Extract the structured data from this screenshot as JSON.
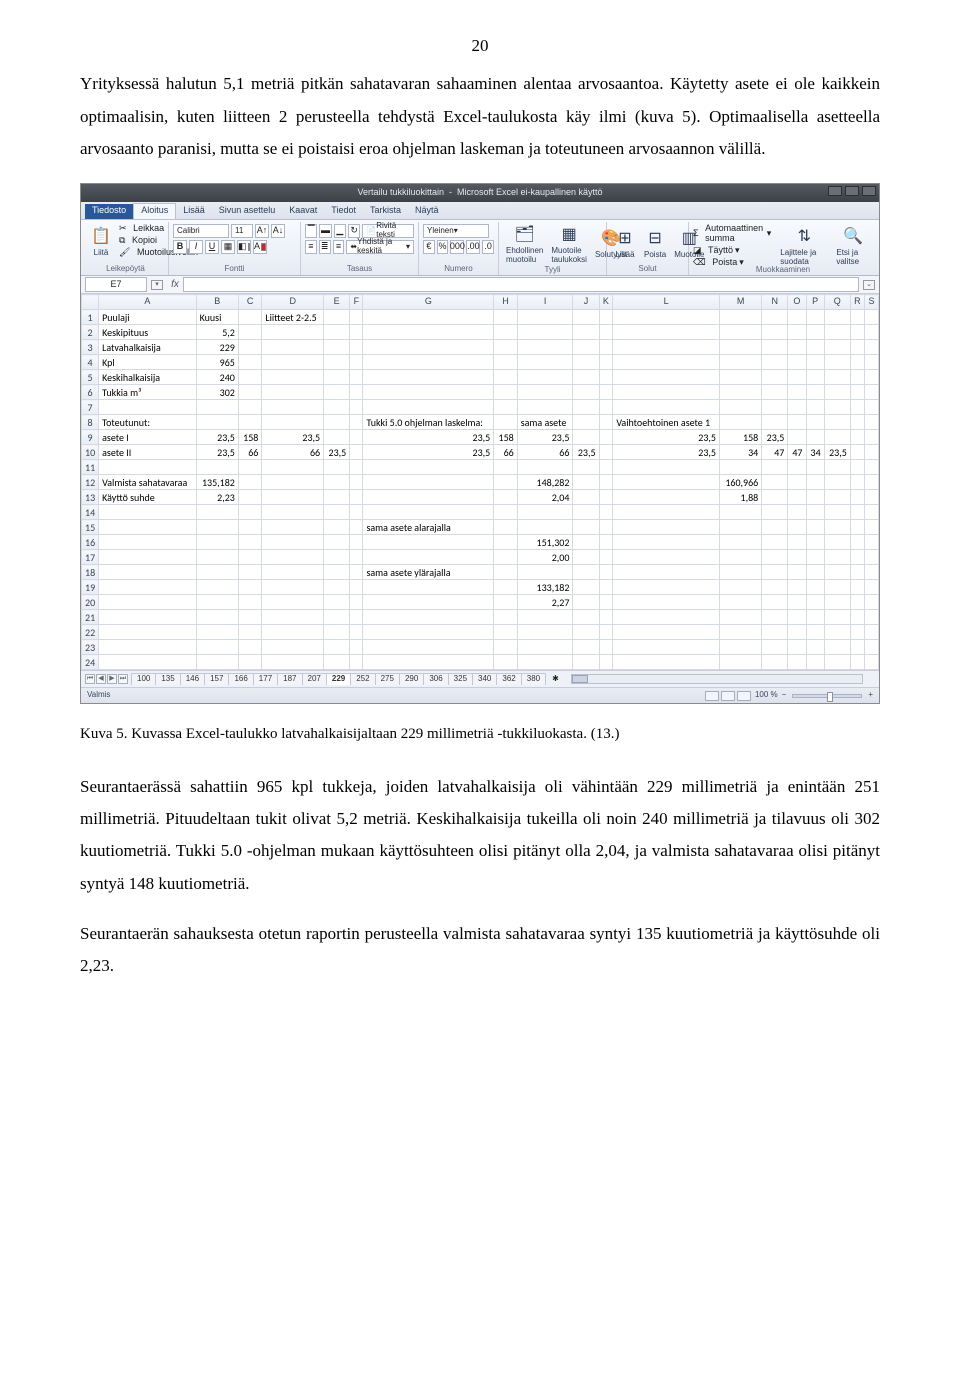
{
  "page_number": "20",
  "para1": "Yrityksessä halutun 5,1 metriä pitkän sahatavaran sahaaminen alentaa arvosaantoa. Käytetty asete ei ole kaikkein optimaalisin, kuten liitteen 2 perusteella tehdystä Excel-taulukosta käy ilmi (kuva 5). Optimaalisella asetteella arvosaanto paranisi, mutta se ei poistaisi eroa ohjelman laskeman ja toteutuneen arvosaannon välillä.",
  "caption": "Kuva 5. Kuvassa Excel-taulukko latvahalkaisijaltaan 229 millimetriä -tukkiluokasta. (13.)",
  "para2": "Seurantaerässä sahattiin 965 kpl tukkeja, joiden latvahalkaisija oli vähintään 229 millimetriä ja enintään 251 millimetriä. Pituudeltaan tukit olivat 5,2 metriä. Keskihalkaisija tukeilla oli noin 240 millimetriä ja tilavuus oli 302 kuutiometriä. Tukki 5.0 -ohjelman mukaan käyttösuhteen olisi pitänyt olla 2,04, ja valmista sahatavaraa olisi pitänyt syntyä 148 kuutiometriä.",
  "para3": "Seurantaerän sahauksesta otetun raportin perusteella valmista sahatavaraa syntyi 135 kuutiometriä ja käyttösuhde oli 2,23.",
  "excel": {
    "title_doc": "Vertailu tukkiluokittain",
    "title_app": "Microsoft Excel ei-kaupallinen käyttö",
    "tabs": [
      "Tiedosto",
      "Aloitus",
      "Lisää",
      "Sivun asettelu",
      "Kaavat",
      "Tiedot",
      "Tarkista",
      "Näytä"
    ],
    "clipboard_items": [
      "Leikkaa",
      "Kopioi",
      "Muotoilusivellin"
    ],
    "group_clipboard": "Leikepöytä",
    "paste": "Liitä",
    "font_name": "Calibri",
    "font_size": "11",
    "group_font": "Fontti",
    "group_align": "Tasaus",
    "wrap": "Rivitä teksti",
    "merge": "Yhdistä ja keskitä",
    "numfmt": "Yleinen",
    "group_number": "Numero",
    "cond": "Ehdollinen muotoilu",
    "tblfmt": "Muotoile taulukoksi",
    "styles": "Solutyylit",
    "group_styles": "Tyyli",
    "insert": "Lisää",
    "delete": "Poista",
    "format": "Muotoile",
    "group_cells": "Solut",
    "autosum": "Automaattinen summa",
    "fill": "Täyttö",
    "clear": "Poista",
    "sort": "Lajittele ja suodata",
    "find": "Etsi ja valitse",
    "group_edit": "Muokkaaminen",
    "namebox": "E7",
    "status": "Valmis",
    "zoom": "100 %",
    "cols": [
      "",
      "A",
      "B",
      "C",
      "D",
      "E",
      "F",
      "G",
      "H",
      "I",
      "J",
      "K",
      "L",
      "M",
      "N",
      "O",
      "P",
      "Q",
      "R",
      "S"
    ],
    "rows": [
      {
        "n": "1",
        "cells": [
          "Puulaji",
          "Kuusi",
          "",
          "Liitteet 2-2.5"
        ]
      },
      {
        "n": "2",
        "cells": [
          "Keskipituus",
          "5,2"
        ]
      },
      {
        "n": "3",
        "cells": [
          "Latvahalkaisija",
          "229"
        ]
      },
      {
        "n": "4",
        "cells": [
          "Kpl",
          "965"
        ]
      },
      {
        "n": "5",
        "cells": [
          "Keskihalkaisija",
          "240"
        ]
      },
      {
        "n": "6",
        "cells": [
          "Tukkia m³",
          "302"
        ]
      },
      {
        "n": "7",
        "cells": []
      },
      {
        "n": "8",
        "cells": [
          "Toteutunut:",
          "",
          "",
          "",
          "",
          "",
          "Tukki 5.0 ohjelman laskelma:",
          "",
          "sama asete",
          "",
          "",
          "Vaihtoehtoinen asete 1"
        ]
      },
      {
        "n": "9",
        "cells": [
          "asete I",
          "23,5",
          "158",
          "23,5",
          "",
          "",
          "23,5",
          "158",
          "23,5",
          "",
          "",
          "23,5",
          "158",
          "23,5"
        ]
      },
      {
        "n": "10",
        "cells": [
          "asete II",
          "23,5",
          "66",
          "66",
          "23,5",
          "",
          "23,5",
          "66",
          "66",
          "23,5",
          "",
          "23,5",
          "34",
          "47",
          "47",
          "34",
          "23,5"
        ]
      },
      {
        "n": "11",
        "cells": []
      },
      {
        "n": "12",
        "cells": [
          "Valmista sahatavaraa",
          "135,182",
          "",
          "",
          "",
          "",
          "",
          "",
          "148,282",
          "",
          "",
          "",
          "160,966"
        ]
      },
      {
        "n": "13",
        "cells": [
          "Käyttö suhde",
          "2,23",
          "",
          "",
          "",
          "",
          "",
          "",
          "2,04",
          "",
          "",
          "",
          "1,88"
        ]
      },
      {
        "n": "14",
        "cells": []
      },
      {
        "n": "15",
        "cells": [
          "",
          "",
          "",
          "",
          "",
          "",
          "sama asete alarajalla"
        ]
      },
      {
        "n": "16",
        "cells": [
          "",
          "",
          "",
          "",
          "",
          "",
          "",
          "",
          "151,302"
        ]
      },
      {
        "n": "17",
        "cells": [
          "",
          "",
          "",
          "",
          "",
          "",
          "",
          "",
          "2,00"
        ]
      },
      {
        "n": "18",
        "cells": [
          "",
          "",
          "",
          "",
          "",
          "",
          "sama asete ylärajalla"
        ]
      },
      {
        "n": "19",
        "cells": [
          "",
          "",
          "",
          "",
          "",
          "",
          "",
          "",
          "133,182"
        ]
      },
      {
        "n": "20",
        "cells": [
          "",
          "",
          "",
          "",
          "",
          "",
          "",
          "",
          "2,27"
        ]
      },
      {
        "n": "21",
        "cells": []
      },
      {
        "n": "22",
        "cells": []
      },
      {
        "n": "23",
        "cells": []
      },
      {
        "n": "24",
        "cells": []
      }
    ],
    "sheets": [
      "100",
      "135",
      "146",
      "157",
      "166",
      "177",
      "187",
      "207",
      "229",
      "252",
      "275",
      "290",
      "306",
      "325",
      "340",
      "362",
      "380"
    ],
    "active_sheet": "229"
  }
}
